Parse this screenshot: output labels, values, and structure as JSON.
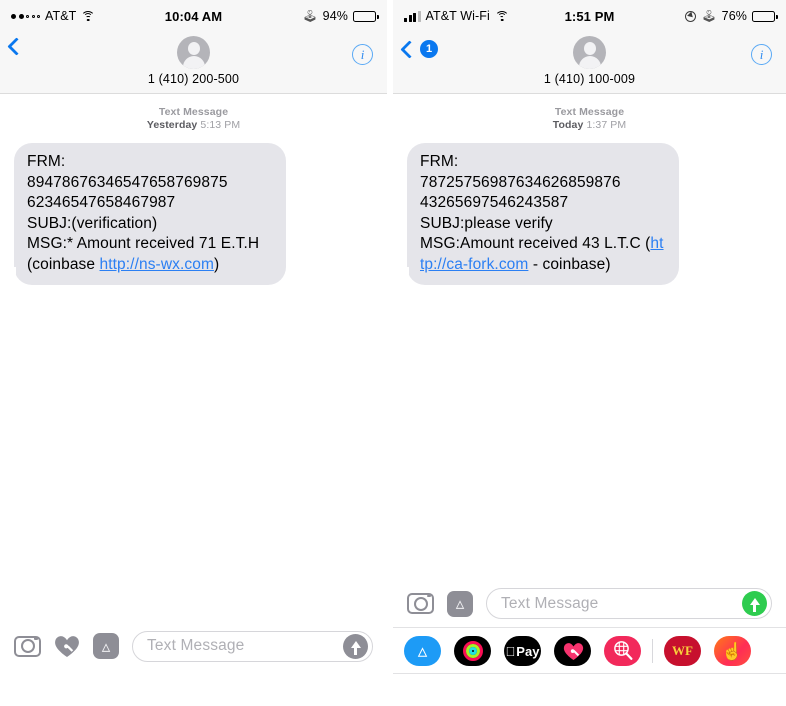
{
  "panels": [
    {
      "id": "left",
      "status": {
        "carrier": "AT&T",
        "signal_style": "dots",
        "signal_dots_filled": 2,
        "signal_dots_total": 5,
        "wifi": true,
        "time": "10:04 AM",
        "bluetooth_icon": "bluetooth-icon",
        "battery_percent": "94%",
        "battery_fill": 88
      },
      "nav": {
        "back_icon": "back-chevron-icon",
        "back_badge": "",
        "avatar_icon": "contact-avatar-icon",
        "phone_number": "1 (410) 200-500",
        "info_label": "i"
      },
      "timestamp": {
        "kind": "Text Message",
        "day": "Yesterday",
        "clock": "5:13 PM"
      },
      "message": {
        "line1": "FRM:",
        "line2": "89478676346547658769875",
        "line3": "62346547658467987",
        "line4": "SUBJ:(verification)",
        "line5_pre": "MSG:* Amount received 71 E.T.H (coinbase ",
        "link_text": "http://ns-wx.com",
        "line5_post": ")"
      },
      "toolbar": {
        "camera_icon": "camera-icon",
        "digital_touch_icon": "digital-touch-heart-icon",
        "appstore_icon": "app-store-icon",
        "input_placeholder": "Text Message",
        "send_icon": "send-arrow-icon",
        "send_color": "#8e8e96"
      },
      "app_drawer": []
    },
    {
      "id": "right",
      "status": {
        "carrier": "AT&T Wi-Fi",
        "signal_style": "bars",
        "signal_bars_filled": 3,
        "signal_bars_total": 4,
        "wifi": true,
        "time": "1:51 PM",
        "location_icon": "location-services-icon",
        "bluetooth_icon": "bluetooth-icon",
        "battery_percent": "76%",
        "battery_fill": 76
      },
      "nav": {
        "back_icon": "back-chevron-icon",
        "back_badge": "1",
        "avatar_icon": "contact-avatar-icon",
        "phone_number": "1 (410) 100-009",
        "info_label": "i"
      },
      "timestamp": {
        "kind": "Text Message",
        "day": "Today",
        "clock": "1:37 PM"
      },
      "message": {
        "line1": "FRM:",
        "line2": "78725756987634626859876",
        "line3": "43265697546243587",
        "line4": "SUBJ:please verify",
        "line5_pre": "MSG:Amount received 43 L.T.C (",
        "link_text": "http://ca-fork.com",
        "line5_post": " - coinbase)"
      },
      "toolbar": {
        "camera_icon": "camera-icon",
        "appstore_icon": "app-store-icon",
        "input_placeholder": "Text Message",
        "send_icon": "send-arrow-icon",
        "send_color": "#2ecc4f"
      },
      "app_drawer": [
        {
          "name": "app-store-app",
          "label": "",
          "kind": "appstore-blue"
        },
        {
          "name": "activity-rings-app",
          "label": "",
          "kind": "activity"
        },
        {
          "name": "apple-pay-app",
          "label": "Pay",
          "kind": "applepay"
        },
        {
          "name": "digital-touch-app",
          "label": "",
          "kind": "digitaltouch"
        },
        {
          "name": "app-clip-app",
          "label": "",
          "kind": "appclip"
        },
        {
          "name": "separator",
          "label": "",
          "kind": "separator"
        },
        {
          "name": "wells-fargo-app",
          "label": "WF",
          "kind": "wf"
        },
        {
          "name": "partial-orange-app",
          "label": "",
          "kind": "lastapp"
        }
      ]
    }
  ],
  "colors": {
    "ios_blue": "#0a78ef",
    "bubble_gray": "#e5e5ea",
    "link_blue": "#2b7ff3",
    "send_green": "#2ecc4f",
    "chrome_gray": "#f7f7f7"
  }
}
